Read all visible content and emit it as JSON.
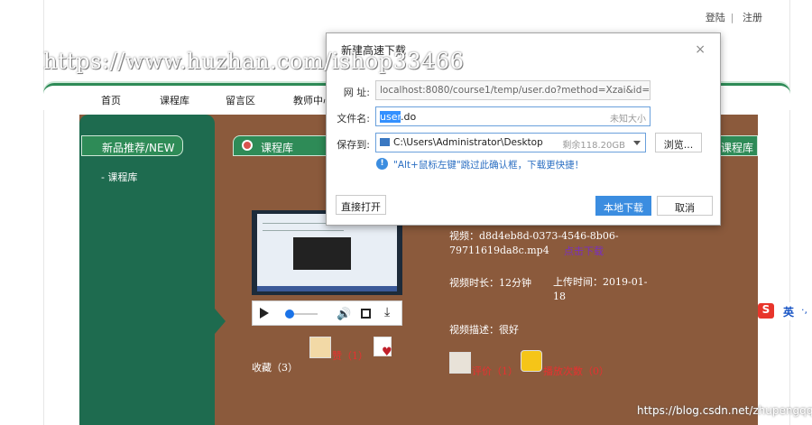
{
  "header": {
    "login": "登陆",
    "register": "注册",
    "separator": "|"
  },
  "watermark": "https://www.huzhan.com/ishop33466",
  "nav": {
    "items": [
      "首页",
      "课程库",
      "留言区",
      "教师中心"
    ]
  },
  "sidebar": {
    "title": "新品推荐/NEW",
    "link": "- 课程库"
  },
  "content": {
    "tab": "课程库",
    "right_tab": "课程库",
    "video_label": "视频：d8d4eb8d-0373-4546-8b06-79711619da8c.mp4",
    "download_link": "点击下载",
    "duration": "视频时长：12分钟",
    "upload_time": "上传时间：2019-01-18",
    "description": "视频描述：很好",
    "favorites": "收藏（3）",
    "likes": "赞（1）",
    "comments": "评价（1）",
    "plays": "播放次数（0）"
  },
  "dialog": {
    "title": "新建高速下载",
    "close": "×",
    "url_label": "网 址:",
    "url_value": "localhost:8080/course1/temp/user.do?method=Xzai&id=-197",
    "filename_label": "文件名:",
    "filename_selected": "user",
    "filename_rest": ".do",
    "filesize": "未知大小",
    "saveto_label": "保存到:",
    "saveto_path": "C:\\Users\\Administrator\\Desktop",
    "free_space": "剩余118.20GB",
    "browse": "浏览...",
    "tip": "\"Alt+鼠标左键\"跳过此确认框，下载更快捷！",
    "open_direct": "直接打开",
    "local_download": "本地下载",
    "cancel": "取消"
  },
  "ime": {
    "label": "英",
    "extra": "·,"
  },
  "footer_watermark": "https://blog.csdn.net/zhupengqq",
  "colors": {
    "green": "#1e6b4f",
    "brown": "#8b5a3c",
    "dialog_blue": "#3b8de0"
  }
}
